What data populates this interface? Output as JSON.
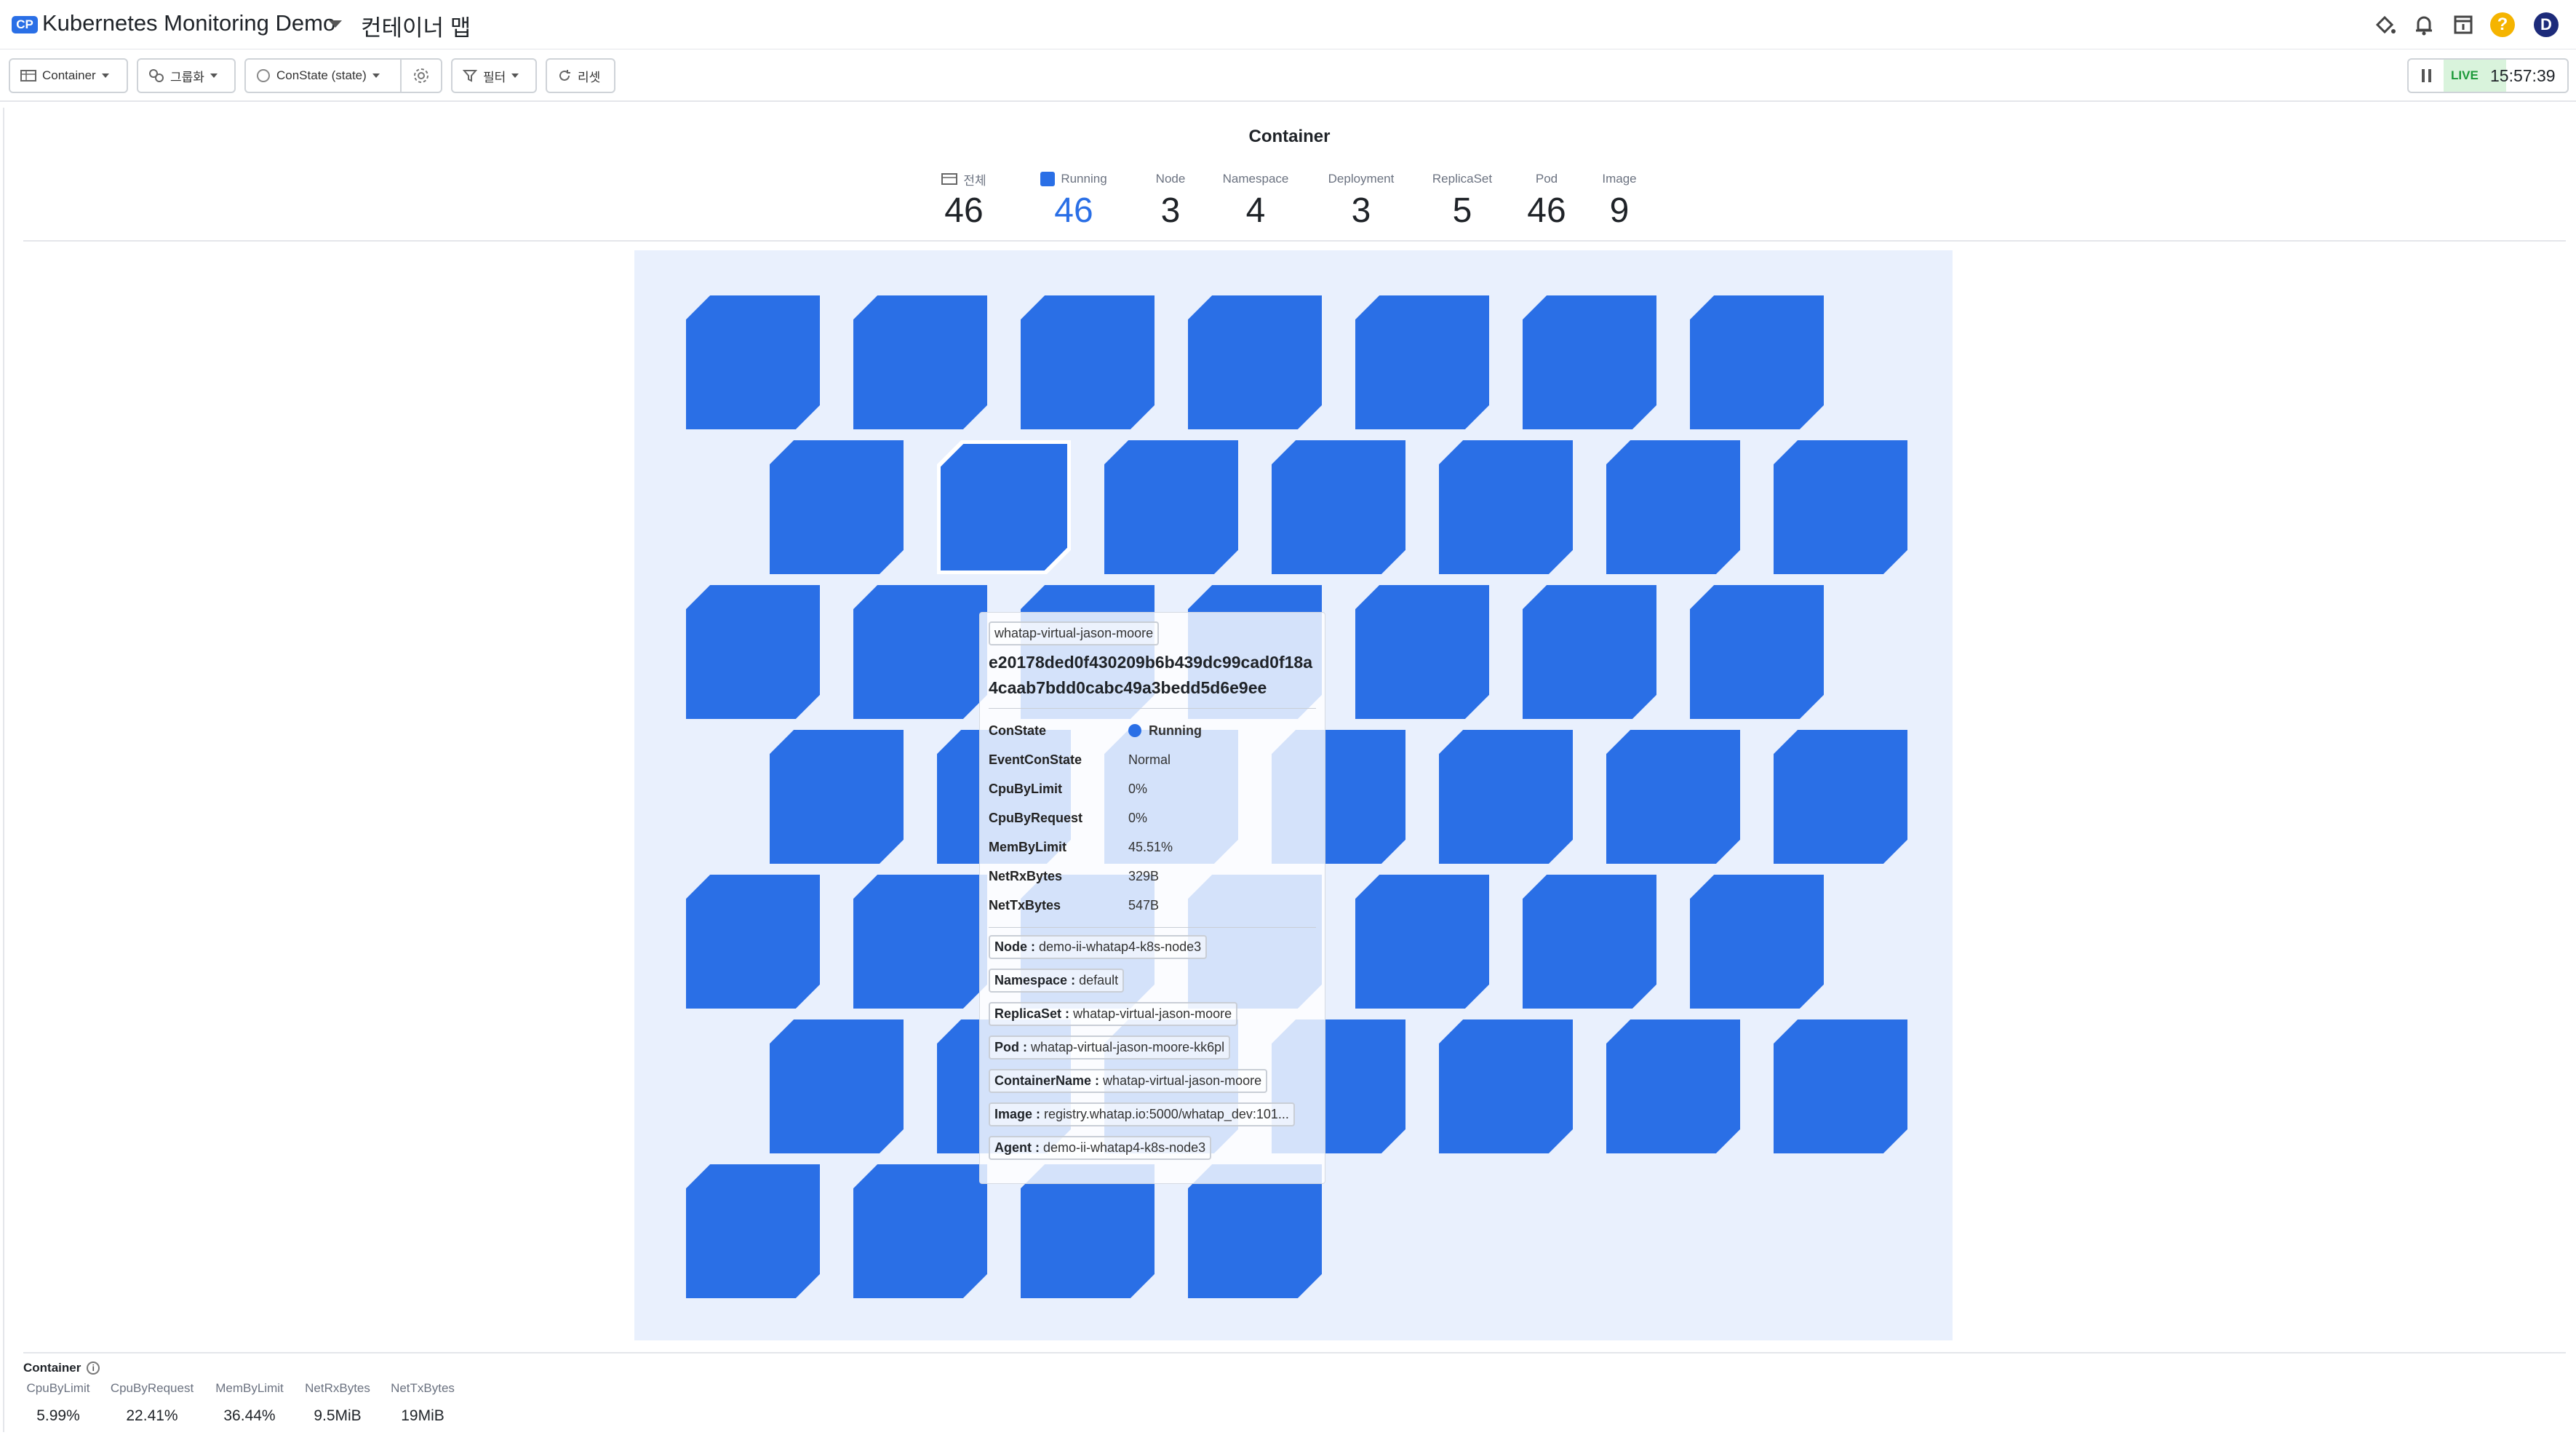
{
  "header": {
    "badge": "CP",
    "project_name": "Kubernetes Monitoring Demo",
    "page_title": "컨테이너 맵",
    "avatar_letter": "D",
    "help_symbol": "?"
  },
  "toolbar": {
    "container_select": "Container",
    "group_button": "그룹화",
    "state_select": "ConState (state)",
    "filter_button": "필터",
    "reset_button": "리셋",
    "live_label": "LIVE",
    "time": "15:57:39"
  },
  "panel": {
    "title": "Container",
    "stats": [
      {
        "label": "전체",
        "value": "46"
      },
      {
        "label": "Running",
        "value": "46"
      },
      {
        "label": "Node",
        "value": "3"
      },
      {
        "label": "Namespace",
        "value": "4"
      },
      {
        "label": "Deployment",
        "value": "3"
      },
      {
        "label": "ReplicaSet",
        "value": "5"
      },
      {
        "label": "Pod",
        "value": "46"
      },
      {
        "label": "Image",
        "value": "9"
      }
    ]
  },
  "map": {
    "tile_count": 46,
    "tile_color": "#2a6fe6",
    "background_color": "#e9f0fd",
    "selected_index": 8
  },
  "tooltip": {
    "name": "whatap-virtual-jason-moore",
    "container_id": "e20178ded0f430209b6b439dc99cad0f18a4caab7bdd0cabc49a3bedd5d6e9ee",
    "metrics": [
      {
        "key": "ConState",
        "value": "Running"
      },
      {
        "key": "EventConState",
        "value": "Normal"
      },
      {
        "key": "CpuByLimit",
        "value": "0%"
      },
      {
        "key": "CpuByRequest",
        "value": "0%"
      },
      {
        "key": "MemByLimit",
        "value": "45.51%"
      },
      {
        "key": "NetRxBytes",
        "value": "329B"
      },
      {
        "key": "NetTxBytes",
        "value": "547B"
      }
    ],
    "tags": [
      {
        "key": "Node :",
        "value": "demo-ii-whatap4-k8s-node3"
      },
      {
        "key": "Namespace :",
        "value": "default"
      },
      {
        "key": "ReplicaSet :",
        "value": "whatap-virtual-jason-moore"
      },
      {
        "key": "Pod :",
        "value": "whatap-virtual-jason-moore-kk6pl"
      },
      {
        "key": "ContainerName :",
        "value": "whatap-virtual-jason-moore"
      },
      {
        "key": "Image :",
        "value": "registry.whatap.io:5000/whatap_dev:101..."
      },
      {
        "key": "Agent :",
        "value": "demo-ii-whatap4-k8s-node3"
      }
    ]
  },
  "summary": {
    "title": "Container",
    "columns": [
      {
        "label": "CpuByLimit",
        "value": "5.99%"
      },
      {
        "label": "CpuByRequest",
        "value": "22.41%"
      },
      {
        "label": "MemByLimit",
        "value": "36.44%"
      },
      {
        "label": "NetRxBytes",
        "value": "9.5MiB"
      },
      {
        "label": "NetTxBytes",
        "value": "19MiB"
      }
    ]
  }
}
